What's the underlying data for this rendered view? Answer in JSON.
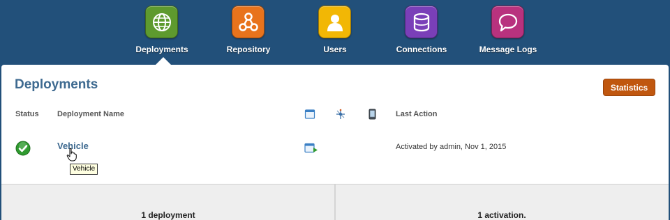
{
  "nav": {
    "items": [
      {
        "label": "Deployments",
        "icon": "globe-icon",
        "color": "#5e9a2e"
      },
      {
        "label": "Repository",
        "icon": "share-nodes-icon",
        "color": "#e8731c"
      },
      {
        "label": "Users",
        "icon": "user-icon",
        "color": "#f2b705"
      },
      {
        "label": "Connections",
        "icon": "database-icon",
        "color": "#7a3fb8"
      },
      {
        "label": "Message Logs",
        "icon": "chat-bubble-icon",
        "color": "#b8327e"
      }
    ],
    "active": "Deployments"
  },
  "page": {
    "title": "Deployments",
    "statistics_label": "Statistics"
  },
  "table": {
    "headers": {
      "status": "Status",
      "name": "Deployment Name",
      "last_action": "Last Action"
    },
    "rows": [
      {
        "status_icon": "check-circle-icon",
        "name": "Vehicle",
        "last_action": "Activated by admin, Nov 1, 2015"
      }
    ]
  },
  "tooltip": {
    "text": "Vehicle"
  },
  "summary": {
    "deployments": "1 deployment",
    "activations": "1 activation."
  },
  "colors": {
    "header_bg": "#22507a",
    "title": "#3e6a90",
    "statistics_button": "#c0570f"
  }
}
